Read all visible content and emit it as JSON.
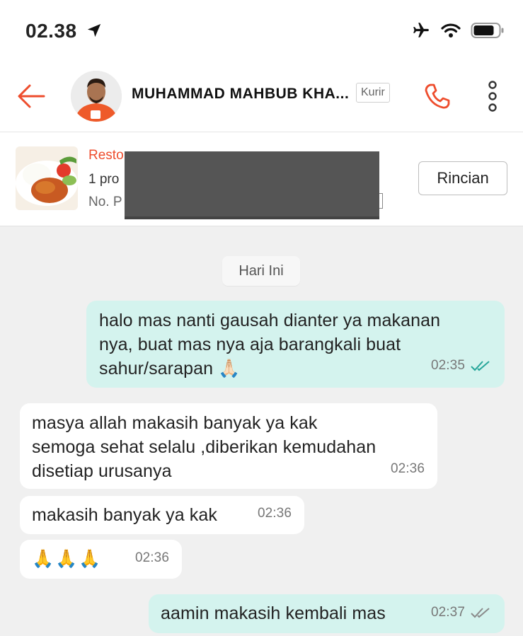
{
  "status_bar": {
    "time": "02.38"
  },
  "header": {
    "contact_name": "MUHAMMAD MAHBUB KHA...",
    "role_badge": "Kurir"
  },
  "order": {
    "restaurant_partial": "Resto",
    "items_partial": "1 pro",
    "order_no_partial": "No. P",
    "detail_button": "Rincian"
  },
  "chat": {
    "date_label": "Hari Ini",
    "messages": [
      {
        "direction": "outgoing",
        "lines": [
          "halo mas nanti gausah dianter ya makanan",
          "nya, buat mas nya aja barangkali buat",
          "sahur/sarapan 🙏🏻"
        ],
        "time": "02:35",
        "read": true
      },
      {
        "direction": "incoming",
        "lines": [
          "masya allah makasih banyak ya kak",
          "semoga sehat selalu ,diberikan kemudahan",
          "disetiap urusanya"
        ],
        "time": "02:36"
      },
      {
        "direction": "incoming",
        "lines": [
          "makasih banyak ya kak"
        ],
        "time": "02:36"
      },
      {
        "direction": "incoming",
        "lines": [
          "🙏🙏🙏"
        ],
        "time": "02:36"
      },
      {
        "direction": "outgoing",
        "lines": [
          "aamin makasih kembali mas"
        ],
        "time": "02:37",
        "read": true
      }
    ]
  },
  "colors": {
    "accent": "#ee4d2d",
    "outgoing_bubble": "#d4f3ee",
    "incoming_bubble": "#ffffff",
    "read_ticks": "#26a69a",
    "chat_bg": "#f0f0f0"
  },
  "icons": [
    "location-arrow-icon",
    "airplane-icon",
    "wifi-icon",
    "battery-icon",
    "back-arrow-icon",
    "phone-icon",
    "more-vertical-icon",
    "double-check-icon"
  ]
}
